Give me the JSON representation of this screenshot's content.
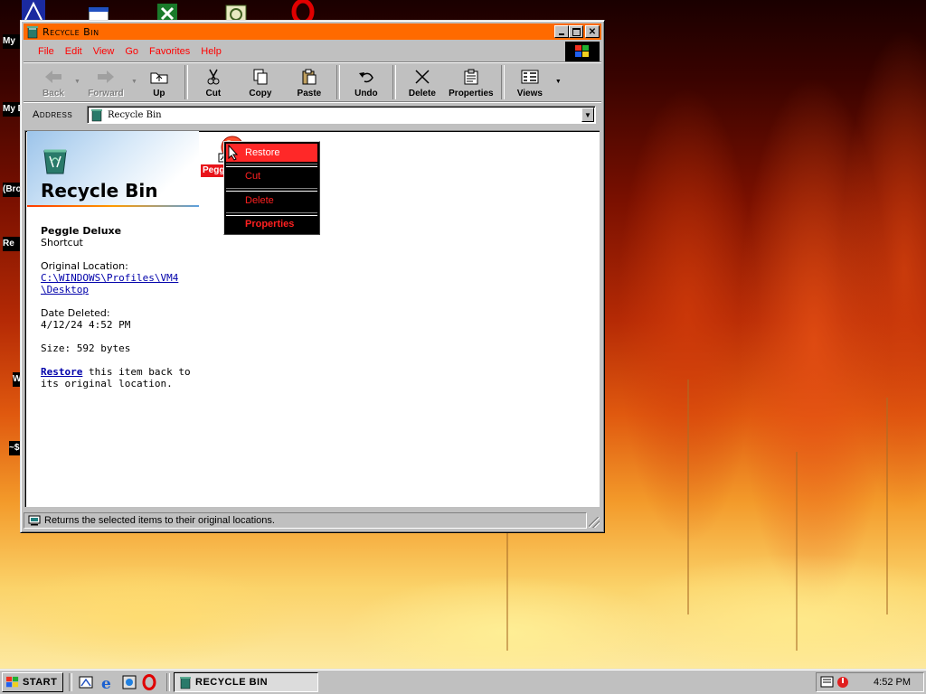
{
  "colors": {
    "title_bar": "#ff6a00",
    "menu_text": "#ff0000",
    "context_menu_bg": "#000000",
    "context_menu_text": "#ff2020",
    "context_menu_selected": "#ff2828",
    "face": "#c0c0c0"
  },
  "desktop": {
    "labels": [
      "My",
      "My D",
      "(Bro",
      "Re",
      "W",
      "~$"
    ]
  },
  "window": {
    "title": "Recycle Bin",
    "menu": [
      "File",
      "Edit",
      "View",
      "Go",
      "Favorites",
      "Help"
    ],
    "toolbar": {
      "back": "Back",
      "forward": "Forward",
      "up": "Up",
      "cut": "Cut",
      "copy": "Copy",
      "paste": "Paste",
      "undo": "Undo",
      "delete": "Delete",
      "properties": "Properties",
      "views": "Views"
    },
    "address": {
      "label": "Address",
      "value": "Recycle Bin"
    },
    "webview": {
      "title": "Recycle Bin",
      "item_name": "Peggle Deluxe",
      "item_type": "Shortcut",
      "orig_label": "Original Location:",
      "orig_path_1": "C:\\WINDOWS\\Profiles\\VM4",
      "orig_path_2": "\\Desktop",
      "date_label": "Date Deleted:",
      "date_value": "4/12/24 4:52 PM",
      "size": "Size: 592 bytes",
      "restore_link": "Restore",
      "restore_text_1": " this item back to",
      "restore_text_2": "its original location."
    },
    "file_item": {
      "label": "Peggl"
    },
    "status": "Returns the selected items to their original locations."
  },
  "context_menu": {
    "items": [
      "Restore",
      "Cut",
      "Delete",
      "Properties"
    ]
  },
  "taskbar": {
    "start": "Start",
    "task": "Recycle Bin",
    "clock": "4:52 PM"
  }
}
